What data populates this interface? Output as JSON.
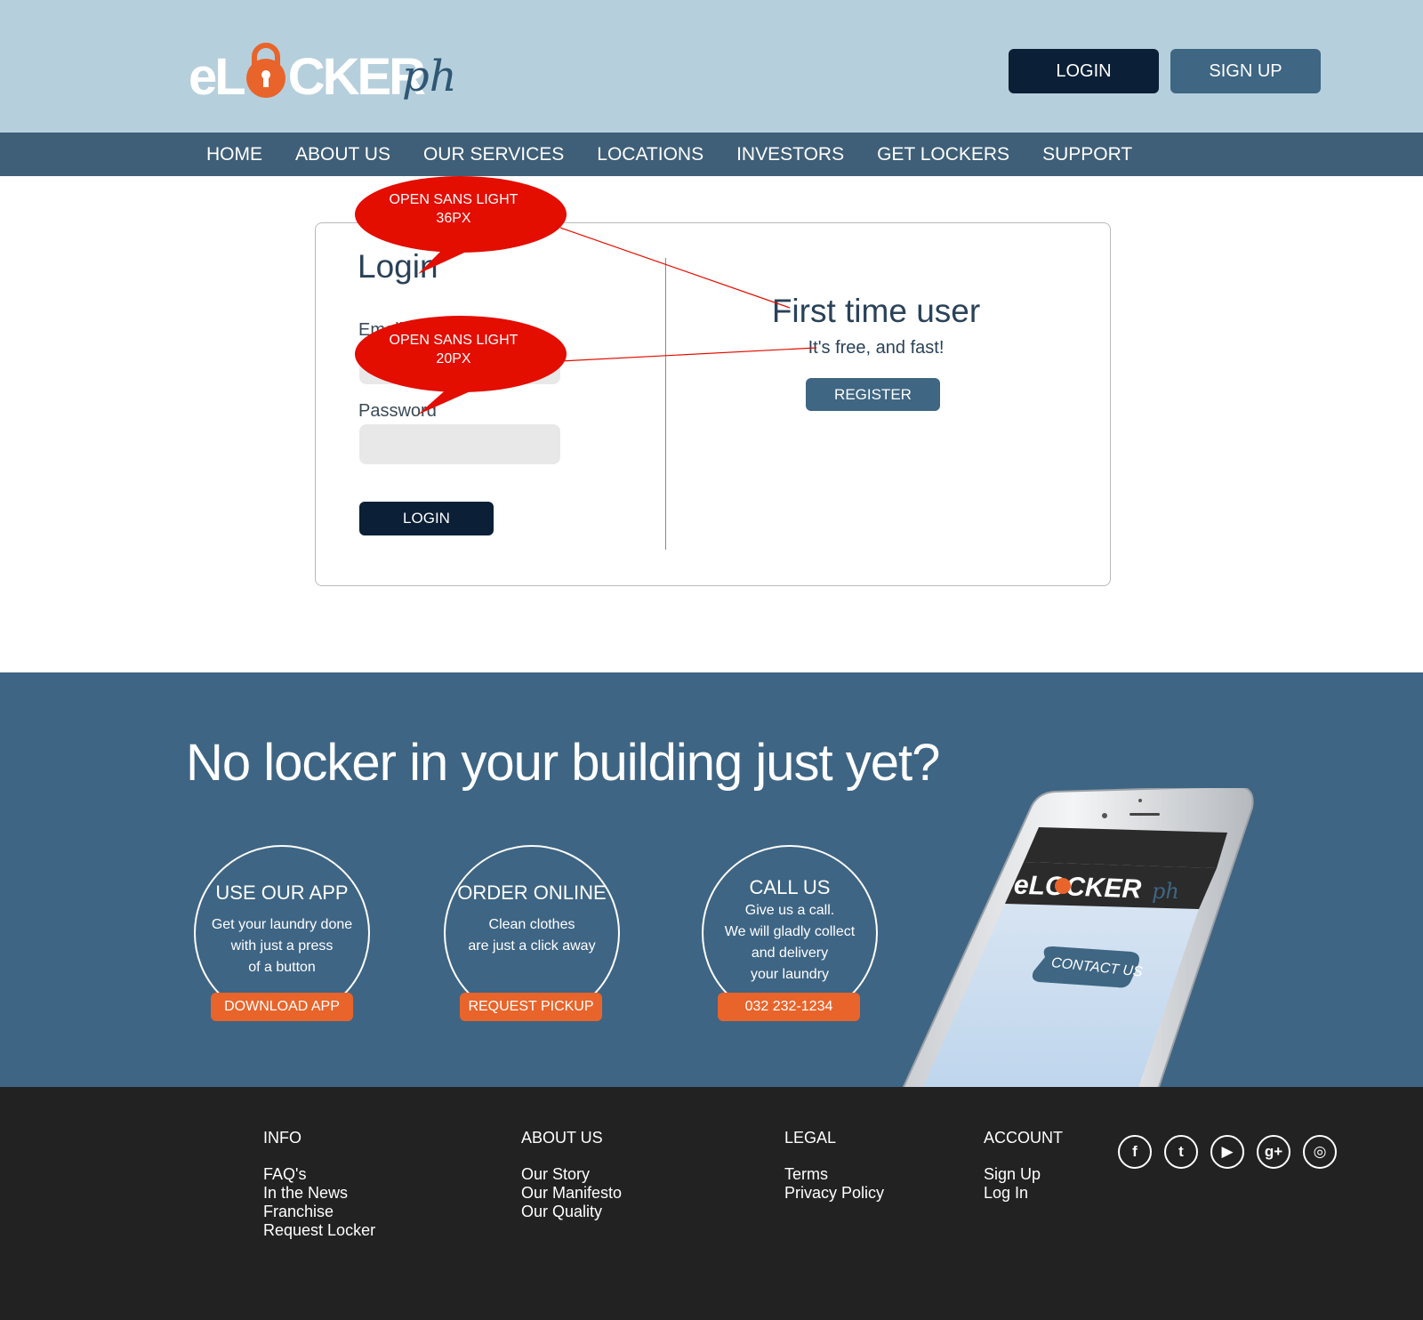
{
  "header": {
    "logo_main": "eLOCKER",
    "logo_suffix": "ph",
    "login_label": "LOGIN",
    "signup_label": "SIGN UP"
  },
  "nav": {
    "items": [
      "HOME",
      "ABOUT US",
      "OUR SERVICES",
      "LOCATIONS",
      "INVESTORS",
      "GET LOCKERS",
      "SUPPORT"
    ]
  },
  "login_form": {
    "title": "Login",
    "email_label": "Email",
    "password_label": "Password",
    "email_value": "",
    "password_value": "",
    "submit_label": "LOGIN"
  },
  "register": {
    "title": "First time user",
    "subtitle": "It's free, and fast!",
    "button_label": "REGISTER"
  },
  "annotations": {
    "bubble1_line1": "OPEN SANS LIGHT",
    "bubble1_line2": "36PX",
    "bubble2_line1": "OPEN SANS LIGHT",
    "bubble2_line2": "20PX"
  },
  "promo": {
    "title": "No locker in your building just yet?",
    "cards": [
      {
        "title": "USE OUR APP",
        "lines": [
          "Get your laundry done",
          "with just a press",
          "of a button"
        ],
        "button": "DOWNLOAD APP"
      },
      {
        "title": "ORDER ONLINE",
        "lines": [
          "Clean clothes",
          "are just a click away"
        ],
        "button": "REQUEST PICKUP"
      },
      {
        "title": "CALL US",
        "lines": [
          "Give us a call.",
          "We will gladly collect",
          "and delivery",
          "your laundry"
        ],
        "button": "032 232-1234"
      }
    ],
    "phone_logo": "eLOCKER",
    "phone_logo_suffix": "ph",
    "phone_button": "CONTACT US"
  },
  "footer": {
    "columns": [
      {
        "title": "INFO",
        "links": [
          "FAQ's",
          "In the News",
          "Franchise",
          "Request Locker"
        ]
      },
      {
        "title": "ABOUT US",
        "links": [
          "Our Story",
          "Our Manifesto",
          "Our Quality"
        ]
      },
      {
        "title": "LEGAL",
        "links": [
          "Terms",
          "Privacy Policy"
        ]
      },
      {
        "title": "ACCOUNT",
        "links": [
          "Sign Up",
          "Log In"
        ]
      }
    ],
    "socials": [
      {
        "name": "facebook-icon",
        "glyph": "f"
      },
      {
        "name": "twitter-icon",
        "glyph": "t"
      },
      {
        "name": "youtube-icon",
        "glyph": "▶"
      },
      {
        "name": "google-plus-icon",
        "glyph": "g+"
      },
      {
        "name": "instagram-icon",
        "glyph": "◎"
      }
    ]
  },
  "colors": {
    "header_bg": "#b6cfdc",
    "nav_bg": "#3f5f78",
    "dark_button": "#0b1f36",
    "blue_button": "#3f6683",
    "accent_orange": "#e8642a",
    "annotation_red": "#e30d00",
    "promo_bg": "#3e6584",
    "footer_bg": "#222222"
  }
}
